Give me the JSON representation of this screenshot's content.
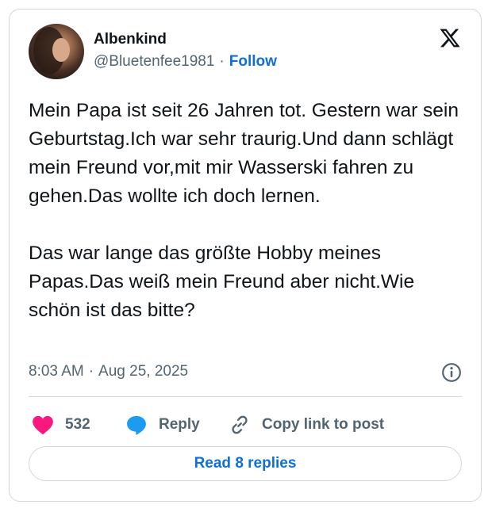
{
  "author": {
    "name": "Albenkind",
    "handle": "@Bluetenfee1981",
    "separator": "·",
    "follow_label": "Follow"
  },
  "tweet": {
    "text": "Mein Papa ist seit 26 Jahren tot. Gestern war sein Geburtstag.Ich war sehr traurig.Und dann schlägt mein Freund vor,mit mir Wasserski fahren zu gehen.Das wollte ich doch lernen.\n\nDas war lange das größte Hobby meines Papas.Das weiß mein Freund aber nicht.Wie schön ist das bitte?",
    "time": "8:03 AM",
    "separator": "·",
    "date": "Aug 25, 2025"
  },
  "actions": {
    "like_count": "532",
    "reply_label": "Reply",
    "copy_label": "Copy link to post"
  },
  "read_replies_label": "Read 8 replies",
  "colors": {
    "accent": "#0f6fd8",
    "like": "#f91880",
    "reply_bubble": "#1d9bf0",
    "muted": "#536471",
    "border": "#cfd9de"
  },
  "icons": {
    "brand": "x-logo-icon",
    "info": "info-icon",
    "like": "heart-icon",
    "reply": "speech-bubble-icon",
    "copy": "link-icon"
  }
}
